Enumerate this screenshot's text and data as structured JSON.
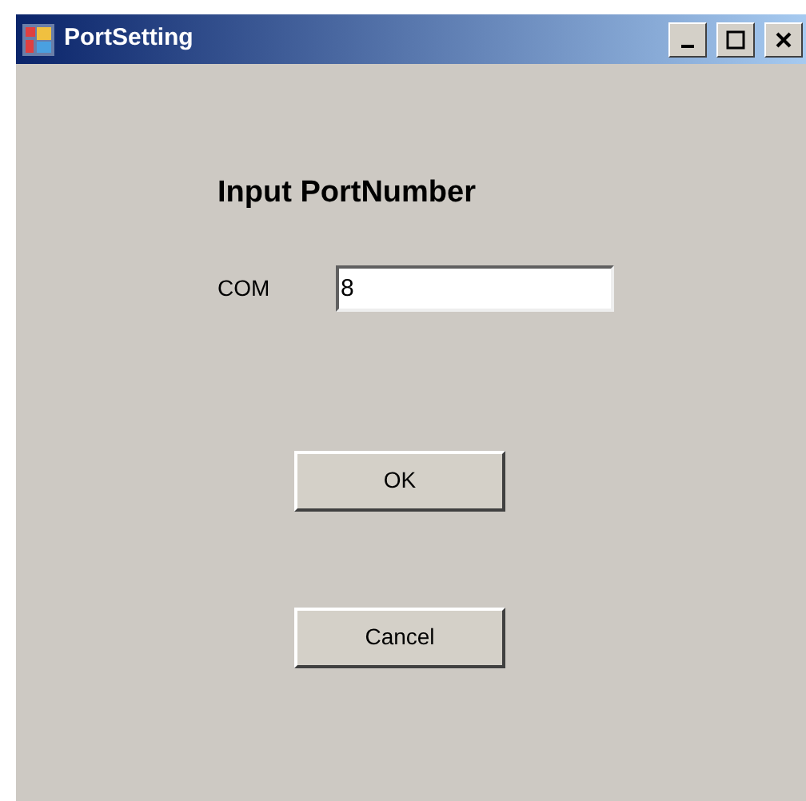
{
  "window": {
    "title": "PortSetting"
  },
  "heading": "Input PortNumber",
  "port_field": {
    "label": "COM",
    "value": "8"
  },
  "buttons": [
    "OK",
    "Cancel"
  ]
}
